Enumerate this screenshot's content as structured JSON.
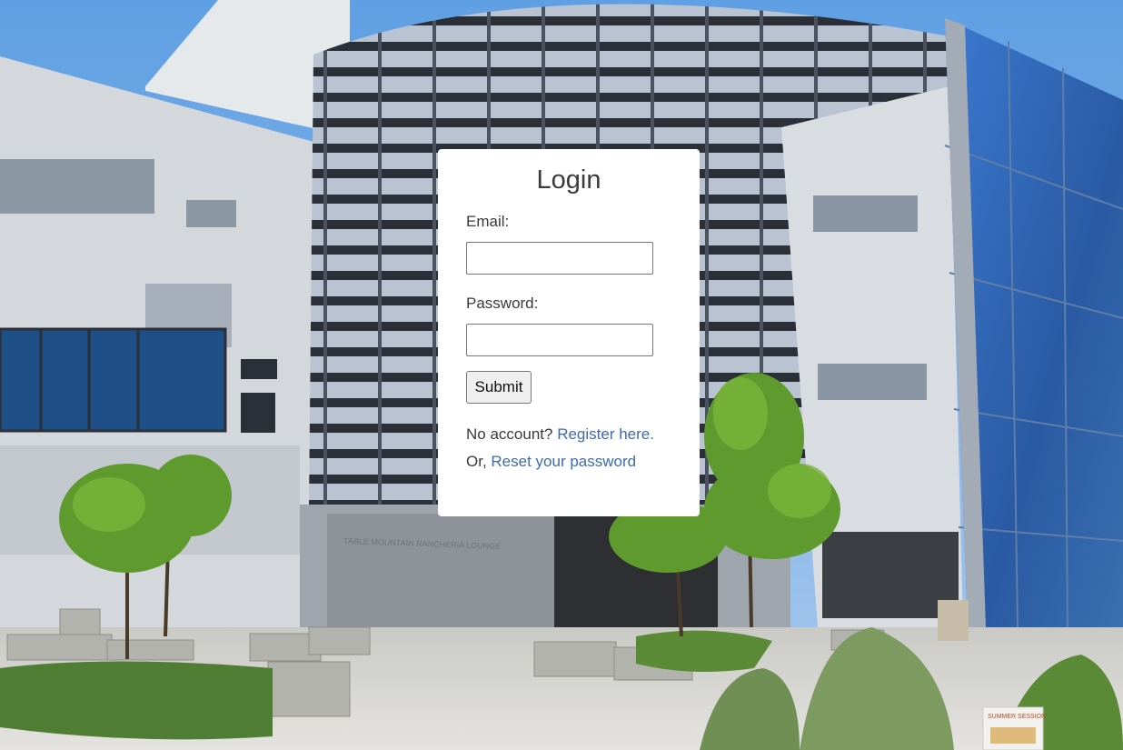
{
  "login": {
    "title": "Login",
    "email_label": "Email:",
    "email_value": "",
    "password_label": "Password:",
    "password_value": "",
    "submit_label": "Submit",
    "no_account_text": "No account?",
    "register_link": "Register here.",
    "or_text": "Or,",
    "reset_link": "Reset your password"
  },
  "background": {
    "sign_text": "TABLE MOUNTAIN RANCHERIA LOUNGE",
    "poster_text": "SUMMER SESSION"
  },
  "colors": {
    "card": "#ffffff",
    "link": "#3d6bb0",
    "sky": "#7fb0e6"
  }
}
